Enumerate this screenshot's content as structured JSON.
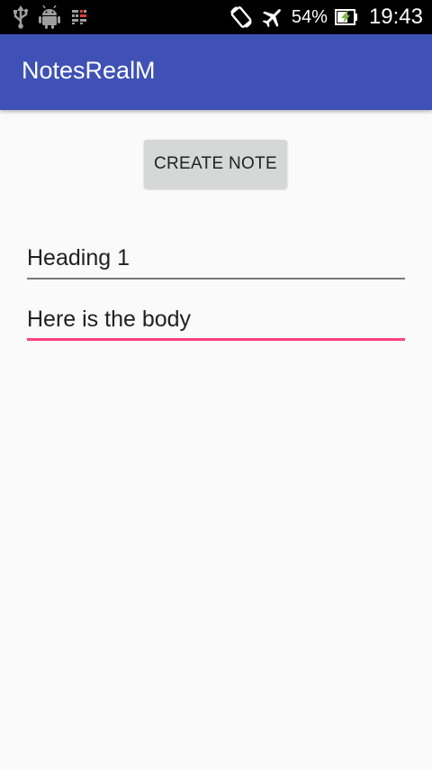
{
  "status_bar": {
    "left_icons": [
      "usb-icon",
      "android-debug-icon",
      "sim-icon"
    ],
    "right_icons": [
      "rotate-icon",
      "airplane-mode-icon",
      "battery-charging-icon"
    ],
    "battery_percent": "54%",
    "time": "19:43"
  },
  "app_bar": {
    "title": "NotesRealM",
    "color": "#3f51b5"
  },
  "main": {
    "create_button_label": "CREATE NOTE",
    "heading_value": "Heading 1",
    "body_value": "Here is the body",
    "accent_color": "#ff4081"
  }
}
